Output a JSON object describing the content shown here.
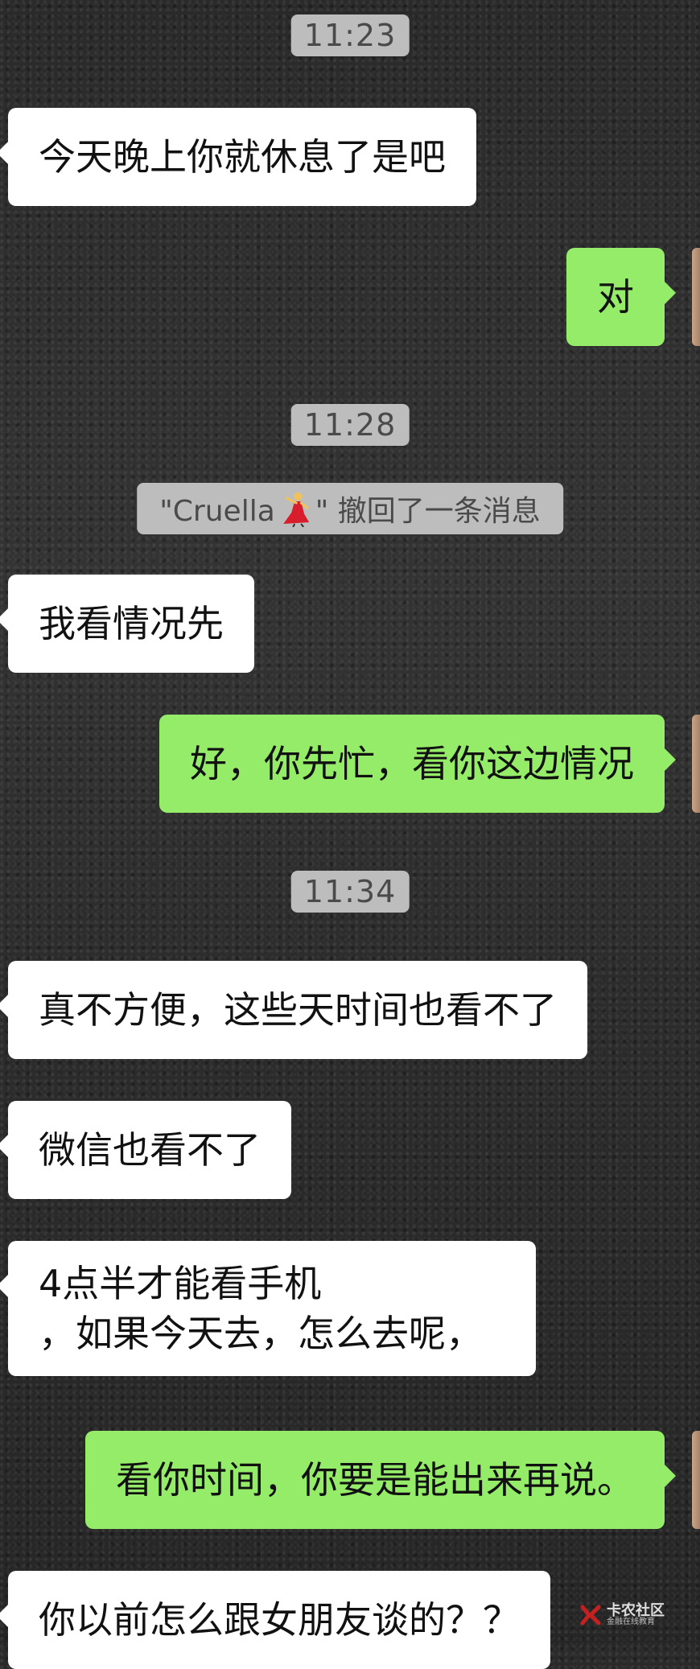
{
  "messages": {
    "t1": "11:23",
    "m1": "今天晚上你就休息了是吧",
    "m2": "对",
    "t2": "11:28",
    "recall_open": "\"Cruella",
    "recall_close": "\" 撤回了一条消息",
    "m3": "我看情况先",
    "m4": "好，你先忙，看你这边情况",
    "t3": "11:34",
    "m5": "真不方便，这些天时间也看不了",
    "m6": "微信也看不了",
    "m7_line1": "4点半才能看手机",
    "m7_line2": "，如果今天去，怎么去呢，",
    "m8": "看你时间，你要是能出来再说。",
    "m9": "你以前怎么跟女朋友谈的？？"
  },
  "icons": {
    "recall_emoji": "dancer-icon",
    "watermark_logo": "watermark-logo-icon"
  },
  "watermark": {
    "main": "卡农社区",
    "sub": "金融在线教育"
  },
  "colors": {
    "incoming_bubble": "#ffffff",
    "outgoing_bubble": "#95ec69",
    "time_pill": "#bdbdbd"
  }
}
